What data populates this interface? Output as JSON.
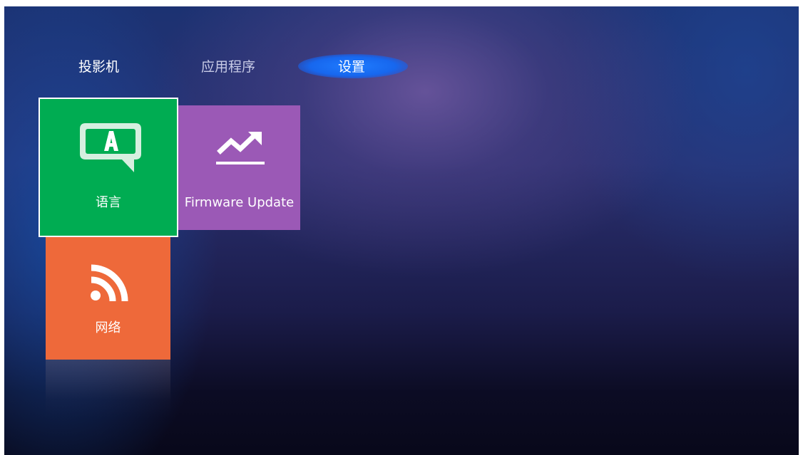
{
  "nav": {
    "tabs": [
      {
        "label": "投影机",
        "selected": false
      },
      {
        "label": "应用程序",
        "selected": false
      },
      {
        "label": "设置",
        "selected": true
      }
    ]
  },
  "tiles": {
    "language": {
      "label": "语言",
      "icon": "language-icon",
      "color": "#00ac52",
      "focused": true
    },
    "firmware": {
      "label": "Firmware Update",
      "icon": "trending-up-icon",
      "color": "#9b59b6"
    },
    "network": {
      "label": "网络",
      "icon": "rss-icon",
      "color": "#ee693a"
    }
  }
}
